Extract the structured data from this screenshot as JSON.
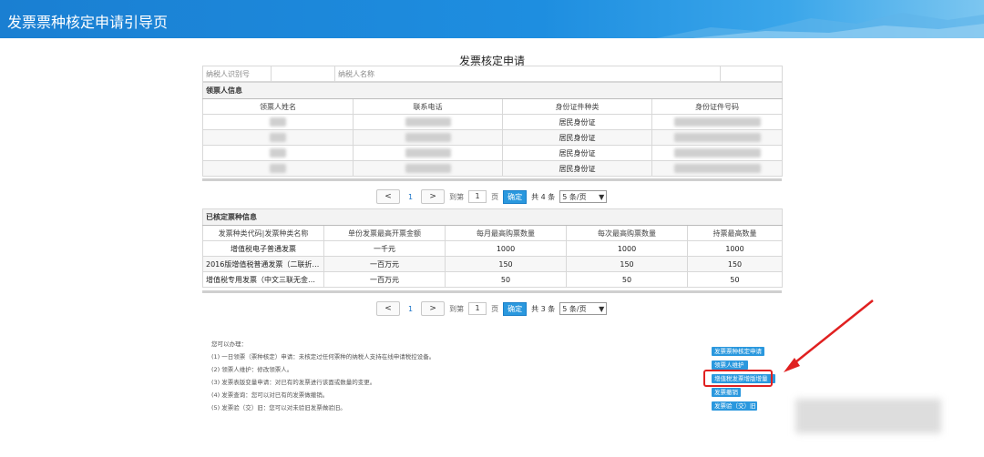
{
  "header": {
    "title": "发票票种核定申请引导页"
  },
  "form": {
    "title": "发票核定申请",
    "taxpayer_id_label": "纳税人识别号",
    "taxpayer_name_label": "纳税人名称"
  },
  "collector": {
    "section_title": "领票人信息",
    "columns": [
      "领票人姓名",
      "联系电话",
      "身份证件种类",
      "身份证件号码"
    ],
    "rows": [
      {
        "id_type": "居民身份证"
      },
      {
        "id_type": "居民身份证"
      },
      {
        "id_type": "居民身份证"
      },
      {
        "id_type": "居民身份证"
      }
    ],
    "pager": {
      "prev": "<",
      "page": "1",
      "next": ">",
      "goto": "到第",
      "input": "1",
      "page_unit": "页",
      "confirm": "确定",
      "total": "共 4 条",
      "page_size": "5 条/页"
    }
  },
  "invoice_types": {
    "section_title": "已核定票种信息",
    "columns": [
      "发票种类代码|发票种类名称",
      "单份发票最高开票金额",
      "每月最高购票数量",
      "每次最高购票数量",
      "持票最高数量"
    ],
    "rows": [
      [
        "增值税电子普通发票",
        "一千元",
        "1000",
        "1000",
        "1000"
      ],
      [
        "2016版增值税普通发票（二联折叠...",
        "一百万元",
        "150",
        "150",
        "150"
      ],
      [
        "增值税专用发票（中文三联无金额...",
        "一百万元",
        "50",
        "50",
        "50"
      ]
    ],
    "pager": {
      "prev": "<",
      "page": "1",
      "next": ">",
      "goto": "到第",
      "input": "1",
      "page_unit": "页",
      "confirm": "确定",
      "total": "共 3 条",
      "page_size": "5 条/页"
    }
  },
  "notes": {
    "intro": "您可以办理：",
    "items": [
      "(1) 一日领票（票种核定）申请：未核定过任何票种的纳税人支持在线申请税控设备。",
      "(2) 领票人维护：修改领票人。",
      "(3) 发票表版变量申请：对已有的发票进行该面或数量的变更。",
      "(4) 发票查询：您可以对已有的发票做撤销。",
      "(5) 发票验（交）旧：您可以对未验旧发票做验旧。"
    ]
  },
  "actions": [
    "发票票种核定申请",
    "领票人维护",
    "增值税发票增版增量",
    "发票撤销",
    "发票验（交）旧"
  ],
  "colors": {
    "accent": "#2a98de",
    "highlight": "#e02020",
    "topbar": "#1e8ee0"
  }
}
